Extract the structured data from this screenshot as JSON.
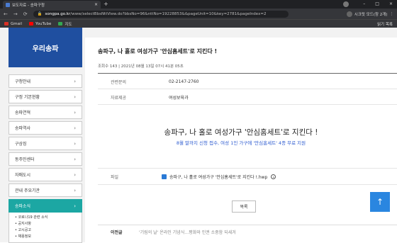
{
  "browser": {
    "tab_title": "보도자료 - 송파구청",
    "tab_close": "×",
    "new_tab": "+",
    "url_host": "songpa.go.kr",
    "url_path": "/www/selectBbsNttView.do?bbsNo=96&nttNo=19228853&&pageUnit=10&key=2781&pageIndex=2",
    "incognito_label": "시크릿 모드(창 2개)",
    "window_controls": [
      "–",
      "□",
      "×"
    ]
  },
  "bookmarks": {
    "items": [
      {
        "label": "Gmail",
        "color": "#d93025"
      },
      {
        "label": "YouTube",
        "color": "#ff0000"
      },
      {
        "label": "지도",
        "color": "#34a853"
      }
    ],
    "right": "읽기 목록"
  },
  "sidebar": {
    "title": "우리송파",
    "items": [
      {
        "label": "구청안내"
      },
      {
        "label": "구정 기본현황"
      },
      {
        "label": "송파연혁"
      },
      {
        "label": "송파역사"
      },
      {
        "label": "구상징"
      },
      {
        "label": "동주민센터"
      },
      {
        "label": "자매도시"
      },
      {
        "label": "관내 주요기관"
      },
      {
        "label": "송파소식",
        "active": true
      }
    ],
    "chevron": "›",
    "submenu": [
      "• 코로나19 관련 소식",
      "• 공지사항",
      "• 고시공고",
      "• 채용정보"
    ]
  },
  "post": {
    "title": "송파구, 나 홀로 여성가구 '안심홈세트'로 지킨다 !",
    "meta": "조회수 143  |  2021년 08월 13일 07시 41분 05초",
    "contact_label": "관련문의",
    "contact_value": "02-2147-2760",
    "provider_label": "자료제공",
    "provider_value": "여성보육과",
    "headline": "송파구, 나 홀로 여성가구 '안심홈세트'로 지킨다 !",
    "subline": "8월 말까지 신청 접수, 여성 1인 가구에 '안심홈세트' 4종 무료 지원",
    "file_label": "파일",
    "file_name": "송파구, 나 홀로 여성가구 '안심홈세트'로 지킨다 !.hwp",
    "list_button": "목록",
    "prev_label": "이전글",
    "prev_title": "'기림의 날' 온라인 기념식…평화와 인권 소중함 되새겨",
    "top_button": "↑"
  },
  "colors": {
    "brand_blue": "#1f4fa0",
    "active_teal": "#1ca7a3",
    "subline_blue": "#2d5bd0",
    "top_button": "#2a86e0"
  }
}
